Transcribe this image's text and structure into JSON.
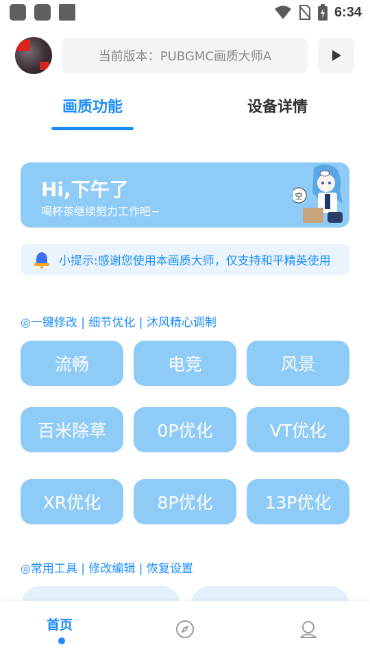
{
  "status_bar": {
    "time": "6:34",
    "icons": [
      "wifi-icon",
      "no-sim-icon",
      "battery-charging-icon"
    ]
  },
  "header": {
    "version_text": "当前版本：PUBGMC画质大师A",
    "play_icon": "play-icon"
  },
  "tabs": [
    {
      "label": "画质功能",
      "active": true
    },
    {
      "label": "设备详情",
      "active": false
    }
  ],
  "greeting": {
    "title": "Hi,下午了",
    "subtitle": "喝杯茶继续努力工作吧~",
    "mascot_label": "空"
  },
  "tip": {
    "icon": "bell-icon",
    "text": "小提示:感谢您使用本画质大师，仅支持和平精英使用"
  },
  "section_quick": {
    "title": "◎一键修改 | 细节优化 | 沐风精心调制",
    "buttons": [
      "流畅",
      "电竞",
      "风景",
      "百米除草",
      "0P优化",
      "VT优化",
      "XR优化",
      "8P优化",
      "13P优化"
    ]
  },
  "section_tools": {
    "title": "◎常用工具 | 修改编辑 | 恢复设置"
  },
  "bottom_nav": {
    "home_label": "首页",
    "discover_icon": "compass-icon",
    "profile_icon": "user-icon"
  },
  "colors": {
    "accent": "#1a8cff",
    "button_bg": "#8ecbf7",
    "tip_bg": "#ebf4fd"
  }
}
